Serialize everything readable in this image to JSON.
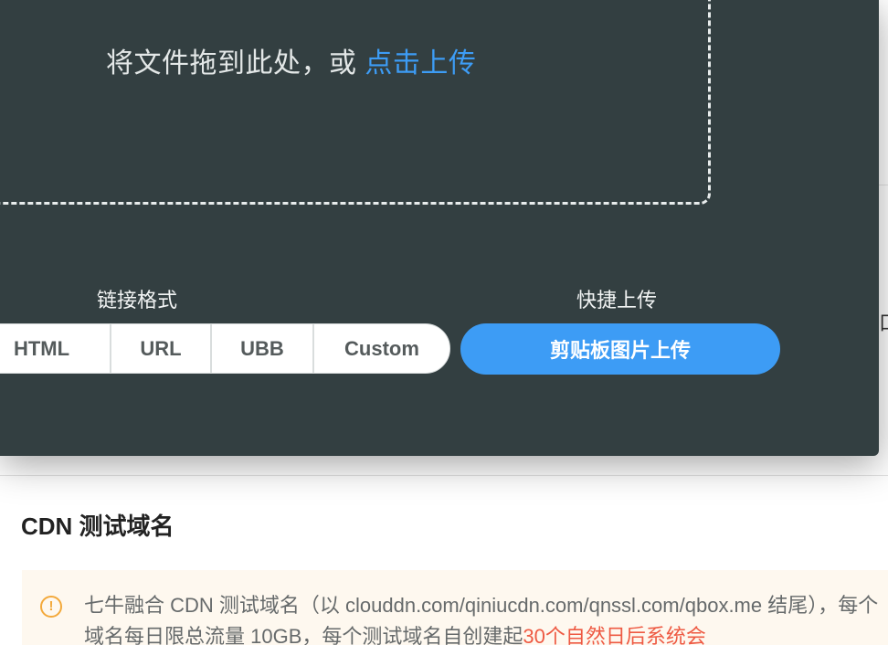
{
  "upload": {
    "drop_prompt": "将文件拖到此处，或 ",
    "click_upload": "点击上传"
  },
  "link_format": {
    "label": "链接格式",
    "options": [
      "HTML",
      "URL",
      "UBB",
      "Custom"
    ]
  },
  "quick_upload": {
    "label": "快捷上传",
    "clipboard_button": "剪贴板图片上传"
  },
  "cdn": {
    "title": "CDN 测试域名",
    "notice_text": "七牛融合 CDN 测试域名（以 clouddn.com/qiniucdn.com/qnssl.com/qbox.me 结尾），每个域名每日限总流量 10GB，每个测试域名自创建起",
    "notice_highlight": "30个自然日后系统会",
    "notice_icon": "exclamation-circle-icon"
  },
  "colors": {
    "panel_bg": "#333f41",
    "accent": "#3d9cf5",
    "warning": "#f3a93b",
    "highlight": "#ee5a43"
  }
}
